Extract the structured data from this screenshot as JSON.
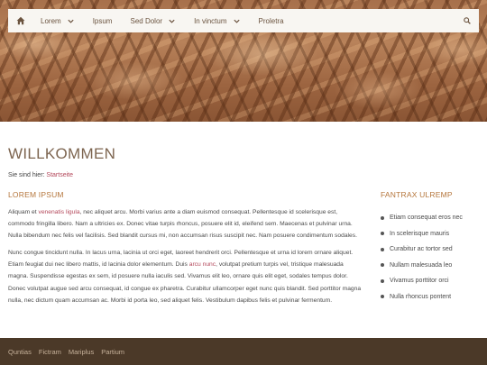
{
  "nav": {
    "home_icon": "home-icon",
    "search_icon": "search-icon",
    "items": [
      {
        "label": "Lorem",
        "has_dropdown": true
      },
      {
        "label": "Ipsum",
        "has_dropdown": false
      },
      {
        "label": "Sed Dolor",
        "has_dropdown": true
      },
      {
        "label": "In vinctum",
        "has_dropdown": true
      },
      {
        "label": "Proletra",
        "has_dropdown": false
      }
    ]
  },
  "page": {
    "title": "WILLKOMMEN",
    "breadcrumb_prefix": "Sie sind hier:",
    "breadcrumb_link": "Startseite"
  },
  "main": {
    "heading": "LOREM IPSUM",
    "p1": {
      "before": "Aliquam et ",
      "link": "venenatis ligula",
      "after": ", nec aliquet arcu. Morbi varius ante a diam euismod consequat. Pellentesque id scelerisque est, commodo fringilla libero. Nam a ultricies ex. Donec vitae turpis rhoncus, posuere elit id, eleifend sem. Maecenas et pulvinar urna. Nulla bibendum nec felis vel facilisis. Sed blandit cursus mi, non accumsan risus suscipit nec. Nam posuere condimentum sodales."
    },
    "p2": {
      "before": "Nunc congue tincidunt nulla. In lacus urna, lacinia ut orci eget, laoreet hendrerit orci. Pellentesque et urna id lorem ornare aliquet. Etiam feugiat dui nec libero mattis, id lacinia dolor elementum. Duis ",
      "link": "arcu nunc",
      "after": ", volutpat pretium turpis vel, tristique malesuada magna. Suspendisse egestas ex sem, id posuere nulla iaculis sed. Vivamus elit leo, ornare quis elit eget, sodales tempus dolor. Donec volutpat augue sed arcu consequat, id congue ex pharetra. Curabitur ullamcorper eget nunc quis blandit. Sed porttitor magna nulla, nec dictum quam accumsan ac. Morbi id porta leo, sed aliquet felis. Vestibulum dapibus felis et pulvinar fermentum."
    }
  },
  "aside": {
    "heading": "FANTRAX ULREMP",
    "items": [
      "Etiam consequat eros nec",
      "In scelerisque mauris",
      "Curabitur ac tortor sed",
      "Nullam malesuada leo",
      "Vivamus porttitor orci",
      "Nulla rhoncus pontent"
    ]
  },
  "footer": {
    "links": [
      "Quntias",
      "Fictram",
      "Mariplus",
      "Partium"
    ]
  },
  "colors": {
    "accent": "#b5763c",
    "link": "#b3475a",
    "footer_bg": "#4b3928",
    "title": "#7d6550"
  }
}
